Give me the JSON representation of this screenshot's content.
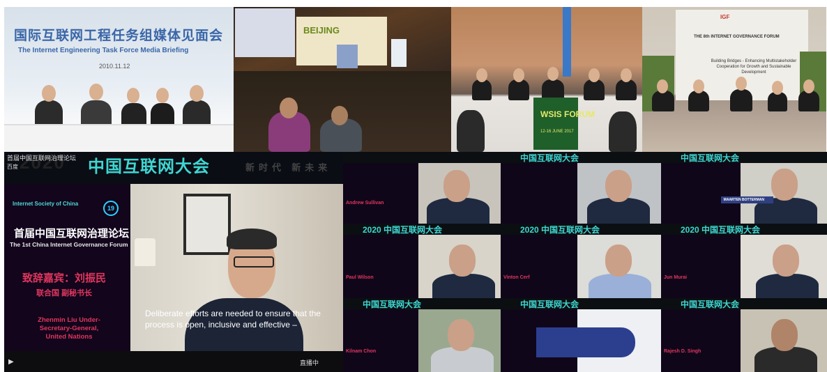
{
  "photo1": {
    "title_cn": "国际互联网工程任务组媒体见面会",
    "title_en": "The Internet Engineering Task Force Media Briefing",
    "date": "2010.11.12"
  },
  "photo2": {
    "banner": "BEIJING"
  },
  "photo3": {
    "wsis_title": "WSIS FORUM",
    "wsis_sub": "12-16 JUNE 2017"
  },
  "photo4": {
    "logo_igf": "IGF",
    "board_title": "THE 8th INTERNET GOVERNANCE FORUM",
    "board_text": "Building Bridges - Enhancing Multistakeholder Cooperation for Growth and Sustainable Development"
  },
  "main_video": {
    "top_left": "首届中国互联网治理论坛",
    "top_left_sub": "百度",
    "conf_year": "2020",
    "conf_name": "中国互联网大会",
    "slogan": "新时代 新未来",
    "badge": "19",
    "org": "Internet Society of China",
    "forum_cn": "首届中国互联网治理论坛",
    "forum_en": "The 1st China Internet Governance Forum",
    "guest_label": "致辞嘉宾：刘振民",
    "guest_role": "联合国 副秘书长",
    "speaker_name": "Zhenmin Liu Under-Secretary-General, United Nations",
    "caption": "Deliberate efforts are needed to ensure that the process is open, inclusive and effective –",
    "status": "直播中"
  },
  "grid": [
    {
      "name": "Andrew Sullivan",
      "header": ""
    },
    {
      "name": "",
      "header": "中国互联网大会"
    },
    {
      "name": "MAARTEN BOTTERMAN",
      "header": "中国互联网大会"
    },
    {
      "name": "Paul Wilson",
      "header": "2020 中国互联网大会"
    },
    {
      "name": "Vinton Cerf",
      "header": "2020 中国互联网大会"
    },
    {
      "name": "Jun Murai",
      "header": "2020 中国互联网大会"
    },
    {
      "name": "Kilnam Chon",
      "header": "中国互联网大会"
    },
    {
      "name": "",
      "header": "中国互联网大会"
    },
    {
      "name": "Rajesh D. Singh",
      "header": "中国互联网大会"
    }
  ]
}
